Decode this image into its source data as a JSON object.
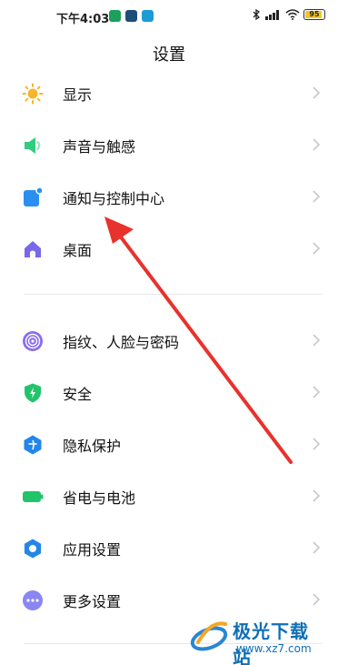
{
  "status": {
    "time": "下午4:03",
    "battery": "95",
    "colors": {
      "notif1": "#1aa05a",
      "notif2": "#1e4d7a",
      "notif3": "#1c9bd6"
    }
  },
  "header": {
    "title": "设置"
  },
  "groups": [
    {
      "items": [
        {
          "label": "显示",
          "icon": "sun-icon"
        },
        {
          "label": "声音与触感",
          "icon": "speaker-icon"
        },
        {
          "label": "通知与控制中心",
          "icon": "notification-icon"
        },
        {
          "label": "桌面",
          "icon": "home-icon"
        }
      ]
    },
    {
      "items": [
        {
          "label": "指纹、人脸与密码",
          "icon": "fingerprint-icon"
        },
        {
          "label": "安全",
          "icon": "shield-icon"
        },
        {
          "label": "隐私保护",
          "icon": "privacy-icon"
        },
        {
          "label": "省电与电池",
          "icon": "battery-icon"
        },
        {
          "label": "应用设置",
          "icon": "gear-icon"
        },
        {
          "label": "更多设置",
          "icon": "more-icon"
        }
      ]
    }
  ],
  "watermark": {
    "name": "极光下载站",
    "url": "www.xz7.com"
  },
  "colors": {
    "arrow": "#e8322c",
    "chevron": "#c8c8c8"
  }
}
